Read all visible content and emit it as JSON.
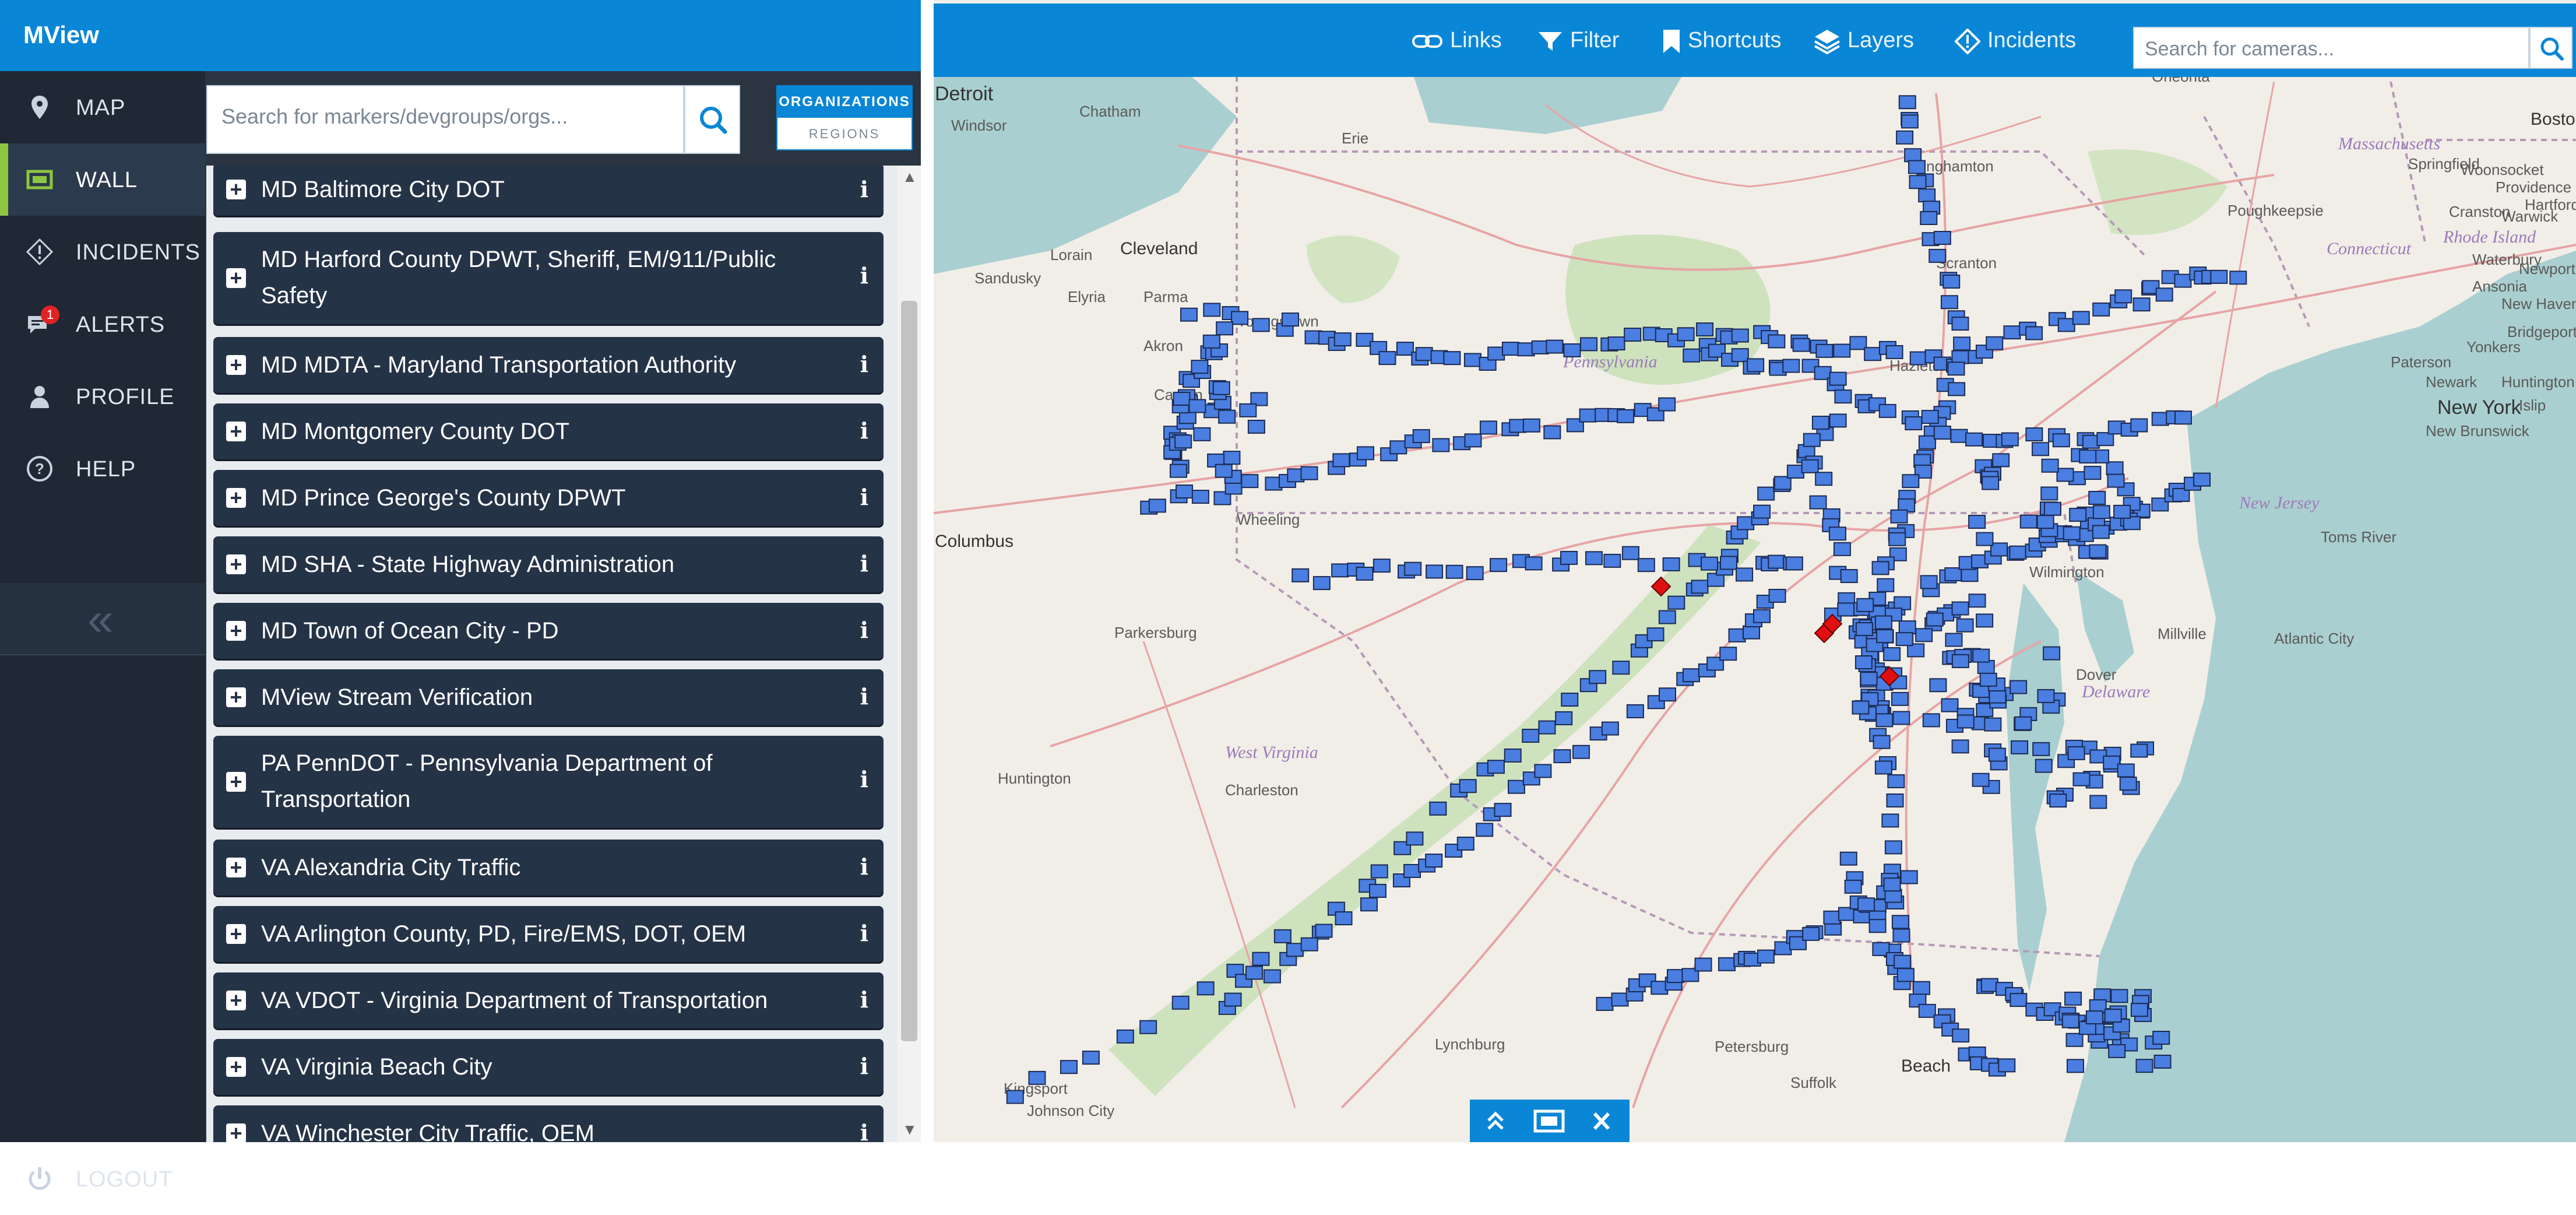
{
  "app": {
    "title": "MView"
  },
  "nav": {
    "items": [
      {
        "label": "MAP",
        "icon": "map-marker-icon"
      },
      {
        "label": "WALL",
        "icon": "video-wall-icon",
        "active": true
      },
      {
        "label": "INCIDENTS",
        "icon": "diamond-alert-icon"
      },
      {
        "label": "ALERTS",
        "icon": "alert-chat-icon",
        "badge": "1"
      },
      {
        "label": "PROFILE",
        "icon": "user-icon"
      },
      {
        "label": "HELP",
        "icon": "question-circle-icon"
      }
    ],
    "collapse_icon": "«",
    "logout_label": "LOGOUT"
  },
  "search": {
    "placeholder": "Search for markers/devgroups/orgs..."
  },
  "toggle": {
    "organizations": "ORGANIZATIONS",
    "regions": "REGIONS"
  },
  "orgs": [
    "MD Baltimore City DOT",
    "MD Harford County DPWT, Sheriff, EM/911/Public Safety",
    "MD MDTA - Maryland Transportation Authority",
    "MD Montgomery County DOT",
    "MD Prince George's County DPWT",
    "MD SHA - State Highway Administration",
    "MD Town of Ocean City - PD",
    "MView Stream Verification",
    "PA PennDOT - Pennsylvania Department of Transportation",
    "VA Alexandria City Traffic",
    "VA Arlington County, PD, Fire/EMS, DOT, OEM",
    "VA VDOT - Virginia Department of Transportation",
    "VA Virginia Beach City",
    "VA Winchester City Traffic, OEM"
  ],
  "map_toolbar": {
    "links": "Links",
    "filter": "Filter",
    "shortcuts": "Shortcuts",
    "layers": "Layers",
    "incidents": "Incidents",
    "camera_search_placeholder": "Search for cameras..."
  },
  "map_labels": {
    "cities": [
      "Detroit",
      "Windsor",
      "Chatham",
      "Lorain",
      "Cleveland",
      "Sandusky",
      "Elyria",
      "Parma",
      "Akron",
      "Canton",
      "Youngstown",
      "Erie",
      "Wheeling",
      "Columbus",
      "Parkersburg",
      "Charleston",
      "Huntington",
      "Lynchburg",
      "Petersburg",
      "Suffolk",
      "Beach",
      "Johnson City",
      "Kingsport",
      "Binghamton",
      "Oneonta",
      "Poughkeepsie",
      "Scranton",
      "Hazleton",
      "Paterson",
      "Yonkers",
      "Newark",
      "New York",
      "New Brunswick",
      "Huntington",
      "Islip",
      "Bridgeport",
      "New Haven",
      "Waterbury",
      "Hartford",
      "Springfield",
      "Woonsocket",
      "Providence",
      "Cranston",
      "Newport",
      "Boston",
      "Toms River",
      "Millville",
      "Atlantic City",
      "Dover",
      "Wilmington",
      "Ansonia",
      "Warwick"
    ],
    "regions": [
      "Massachusetts",
      "Connecticut",
      "Rhode Island",
      "New Jersey",
      "Delaware",
      "West Virginia",
      "Pennsylvania"
    ]
  },
  "colors": {
    "header_blue": "#0a86d6",
    "nav_bg": "#1f2834",
    "org_item_bg": "#253347",
    "active_accent": "#8ec641",
    "camera_marker": "#4a7ee0",
    "incident_marker": "#e01010",
    "water": "#aacfd0",
    "land": "#f1eee8",
    "forest": "#c6dfb3"
  }
}
